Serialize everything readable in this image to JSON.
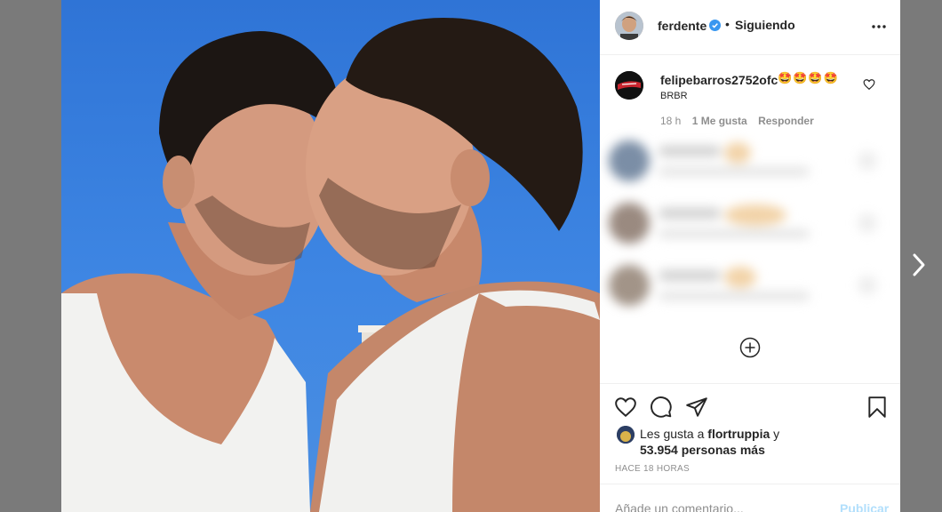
{
  "header": {
    "username": "ferdente",
    "separator": "•",
    "follow_status": "Siguiendo"
  },
  "comment": {
    "username": "felipebarros2752ofc",
    "emojis": "🤩🤩🤩🤩",
    "text": "BRBR",
    "time": "18 h",
    "likes": "1 Me gusta",
    "reply": "Responder"
  },
  "likes": {
    "prefix": "Les gusta a ",
    "user": "flortruppia",
    "connector": " y",
    "others": "53.954 personas más"
  },
  "timestamp": "HACE 18 HORAS",
  "add_comment": {
    "placeholder": "Añade un comentario...",
    "publish": "Publicar"
  },
  "icons": [
    "verified-icon",
    "more-options-icon",
    "comment-like-icon",
    "add-more-comments-icon",
    "like-icon",
    "comment-icon",
    "share-icon",
    "save-icon",
    "next-arrow-icon"
  ],
  "colors": {
    "verified": "#3897f0",
    "publish": "#b2dffc",
    "secondary_text": "#8e8e8e",
    "primary_text": "#262626"
  }
}
